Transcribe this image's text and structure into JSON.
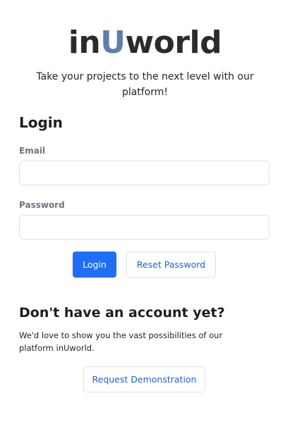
{
  "brand": {
    "logo_prefix": "in",
    "logo_highlight": "U",
    "logo_suffix": "world",
    "tagline": "Take your projects to the next level with our platform!"
  },
  "login": {
    "heading": "Login",
    "email_label": "Email",
    "email_value": "",
    "password_label": "Password",
    "password_value": "",
    "login_label": "Login",
    "reset_label": "Reset Password"
  },
  "signup": {
    "heading": "Don't have an account yet?",
    "text": "We'd love to show you the vast possibilities of our platform inUworld.",
    "demo_label": "Request Demonstration"
  },
  "colors": {
    "primary": "#1f6ef5",
    "logo_dark": "#2b2b2f",
    "logo_accent": "#5c7fae"
  }
}
